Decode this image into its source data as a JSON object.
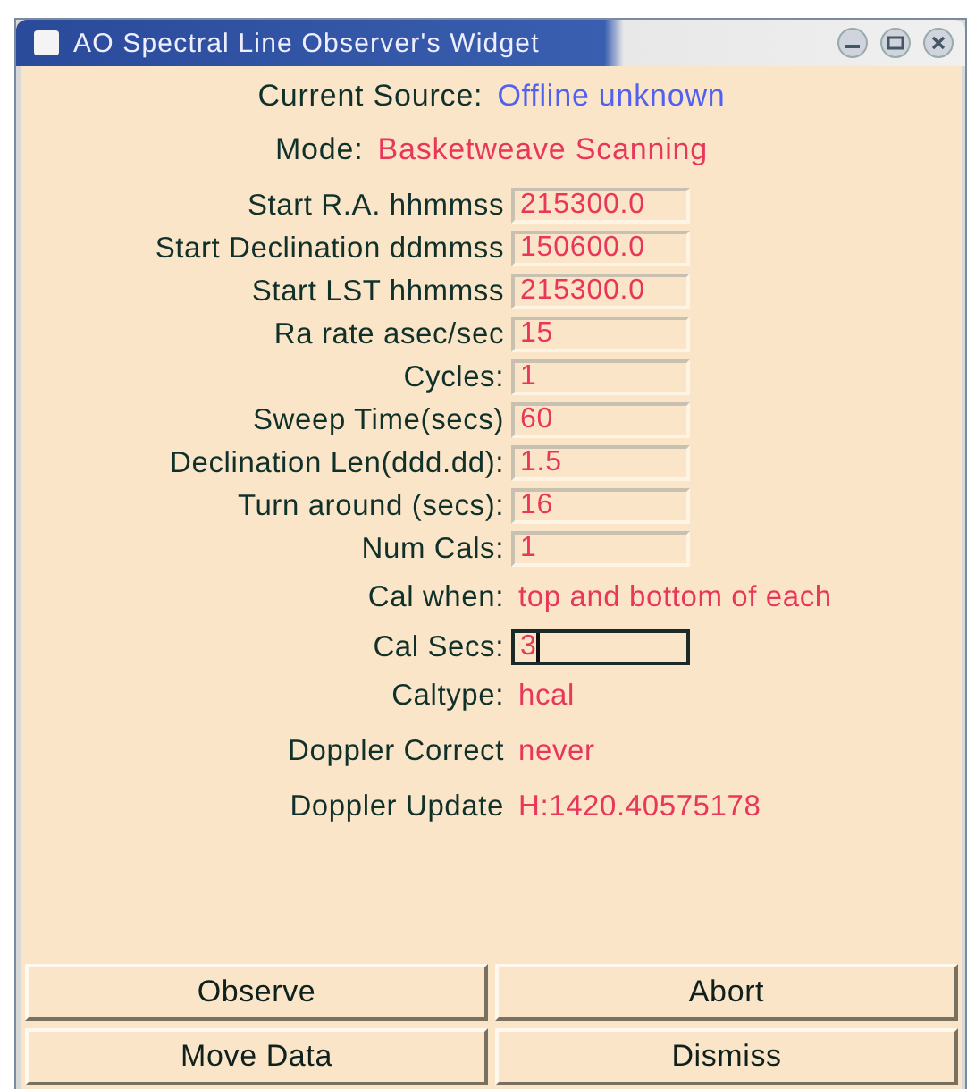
{
  "window": {
    "title": "AO Spectral Line Observer's Widget"
  },
  "header": [
    {
      "label": "Current Source:",
      "value": "Offline unknown",
      "color": "#5060f0"
    },
    {
      "label": "Mode:",
      "value": "Basketweave Scanning",
      "color": "#e8385a"
    }
  ],
  "rows": [
    {
      "kind": "entry",
      "label": "Start R.A. hhmmss",
      "value": "215300.0",
      "focused": false
    },
    {
      "kind": "entry",
      "label": "Start Declination ddmmss",
      "value": "150600.0",
      "focused": false
    },
    {
      "kind": "entry",
      "label": "Start LST hhmmss",
      "value": "215300.0",
      "focused": false
    },
    {
      "kind": "entry",
      "label": "Ra rate asec/sec",
      "value": "15",
      "focused": false
    },
    {
      "kind": "entry",
      "label": "Cycles:",
      "value": "1",
      "focused": false
    },
    {
      "kind": "entry",
      "label": "Sweep Time(secs)",
      "value": "60",
      "focused": false
    },
    {
      "kind": "entry",
      "label": "Declination Len(ddd.dd):",
      "value": "1.5",
      "focused": false
    },
    {
      "kind": "entry",
      "label": "Turn around (secs):",
      "value": "16",
      "focused": false
    },
    {
      "kind": "entry",
      "label": "Num Cals:",
      "value": "1",
      "focused": false
    },
    {
      "kind": "display",
      "label": "Cal when:",
      "value": "top and bottom of each"
    },
    {
      "kind": "entry",
      "label": "Cal Secs:",
      "value": "3",
      "focused": true
    },
    {
      "kind": "display",
      "label": "Caltype:",
      "value": "hcal"
    },
    {
      "kind": "display",
      "label": "Doppler Correct",
      "value": "never"
    },
    {
      "kind": "display",
      "label": "Doppler Update",
      "value": "H:1420.40575178"
    }
  ],
  "buttons": [
    "Observe",
    "Abort",
    "Move Data",
    "Dismiss"
  ]
}
